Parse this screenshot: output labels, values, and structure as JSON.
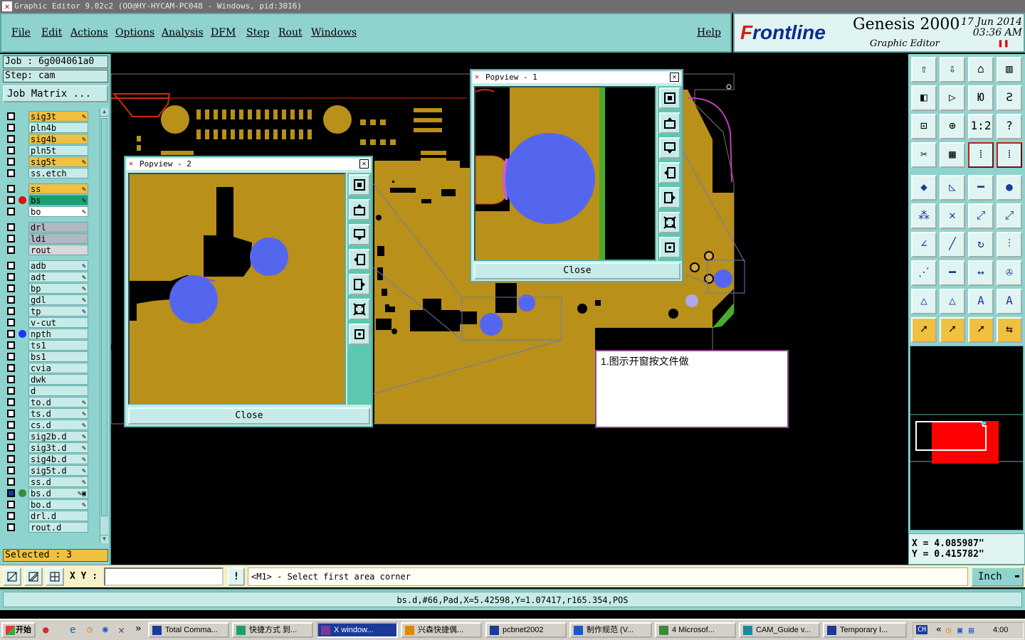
{
  "window_title": "Graphic Editor 9.02c2 (OO@HY-HYCAM-PC048 - Windows, pid:3016)",
  "menu": [
    "File",
    "Edit",
    "Actions",
    "Options",
    "Analysis",
    "DFM",
    "Step",
    "Rout",
    "Windows"
  ],
  "help": "Help",
  "brand": {
    "logo_prefix": "F",
    "logo_rest": "rontline",
    "product": "Genesis 2000",
    "subtitle": "Graphic Editor",
    "date": "17 Jun 2014",
    "time": "03:36 AM"
  },
  "job": {
    "job_label": "Job : 6g004061a0",
    "step_label": "Step: cam",
    "matrix_button": "Job Matrix ..."
  },
  "layers": [
    {
      "name": "sig3t",
      "color": "#f0c040",
      "mark": "✎"
    },
    {
      "name": "pln4b",
      "color": "#c7ebe8",
      "mark": ""
    },
    {
      "name": "sig4b",
      "color": "#f0c040",
      "mark": "✎"
    },
    {
      "name": "pln5t",
      "color": "#c7ebe8",
      "mark": ""
    },
    {
      "name": "sig5t",
      "color": "#f0c040",
      "mark": "✎"
    },
    {
      "name": "ss.etch",
      "color": "#c7ebe8",
      "mark": ""
    },
    {
      "name": "ss",
      "color": "#f0c040",
      "mark": "✎"
    },
    {
      "name": "bs",
      "color": "#1aa070",
      "mark": "✎",
      "dot": "#e01010"
    },
    {
      "name": "bo",
      "color": "#ffffff",
      "mark": "✎"
    },
    {
      "name": "drl",
      "color": "#b0b8c0",
      "mark": ""
    },
    {
      "name": "ldi",
      "color": "#b0b8c0",
      "mark": ""
    },
    {
      "name": "rout",
      "color": "#d8d8d8",
      "mark": ""
    },
    {
      "name": "adb",
      "color": "#c7ebe8",
      "mark": "✎"
    },
    {
      "name": "adt",
      "color": "#c7ebe8",
      "mark": "✎"
    },
    {
      "name": "bp",
      "color": "#c7ebe8",
      "mark": "✎"
    },
    {
      "name": "gdl",
      "color": "#c7ebe8",
      "mark": "✎"
    },
    {
      "name": "tp",
      "color": "#c7ebe8",
      "mark": "✎"
    },
    {
      "name": "v-cut",
      "color": "#c7ebe8",
      "mark": ""
    },
    {
      "name": "npth",
      "color": "#c7ebe8",
      "mark": "",
      "dot": "#2233ff"
    },
    {
      "name": "ts1",
      "color": "#c7ebe8",
      "mark": ""
    },
    {
      "name": "bs1",
      "color": "#c7ebe8",
      "mark": ""
    },
    {
      "name": "cvia",
      "color": "#c7ebe8",
      "mark": ""
    },
    {
      "name": "dwk",
      "color": "#c7ebe8",
      "mark": ""
    },
    {
      "name": "d",
      "color": "#c7ebe8",
      "mark": ""
    },
    {
      "name": "to.d",
      "color": "#c7ebe8",
      "mark": "✎"
    },
    {
      "name": "ts.d",
      "color": "#c7ebe8",
      "mark": "✎"
    },
    {
      "name": "cs.d",
      "color": "#c7ebe8",
      "mark": "✎"
    },
    {
      "name": "sig2b.d",
      "color": "#c7ebe8",
      "mark": "✎"
    },
    {
      "name": "sig3t.d",
      "color": "#c7ebe8",
      "mark": "✎"
    },
    {
      "name": "sig4b.d",
      "color": "#c7ebe8",
      "mark": "✎"
    },
    {
      "name": "sig5t.d",
      "color": "#c7ebe8",
      "mark": "✎"
    },
    {
      "name": "ss.d",
      "color": "#c7ebe8",
      "mark": "✎"
    },
    {
      "name": "bs.d",
      "color": "#c7ebe8",
      "mark": "✎▣",
      "dot": "#3a8a3a"
    },
    {
      "name": "bo.d",
      "color": "#c7ebe8",
      "mark": "✎"
    },
    {
      "name": "drl.d",
      "color": "#c7ebe8",
      "mark": ""
    },
    {
      "name": "rout.d",
      "color": "#c7ebe8",
      "mark": ""
    }
  ],
  "selected_label": "Selected : 3",
  "popview1": {
    "title": "Popview - 1",
    "close": "Close"
  },
  "popview2": {
    "title": "Popview - 2",
    "close": "Close"
  },
  "note_text": "1.图示开窗按文件做",
  "coords": {
    "x": "X = 4.085987\"",
    "y": "Y = 0.415782\""
  },
  "bottom": {
    "xy_label": "X Y :",
    "xy_value": "",
    "prompt": "<M1> - Select first area corner",
    "units": "Inch"
  },
  "status_line": "bs.d,#66,Pad,X=5.42598,Y=1.07417,r165.354,POS",
  "taskbar": {
    "start": "开始",
    "clock": "4:00",
    "ime": "CH",
    "tasks": [
      "Total Comma...",
      "快捷方式 到...",
      "X window...",
      "兴森快捷偶...",
      "pcbnet2002",
      "制作规范 (V...",
      "4 Microsof...",
      "CAM_Guide v...",
      "Temporary I..."
    ]
  },
  "colors": {
    "panel": "#8fd3ce",
    "board": "#b8901a",
    "pad": "#5566ee",
    "selected_layer": "#1aa070"
  }
}
